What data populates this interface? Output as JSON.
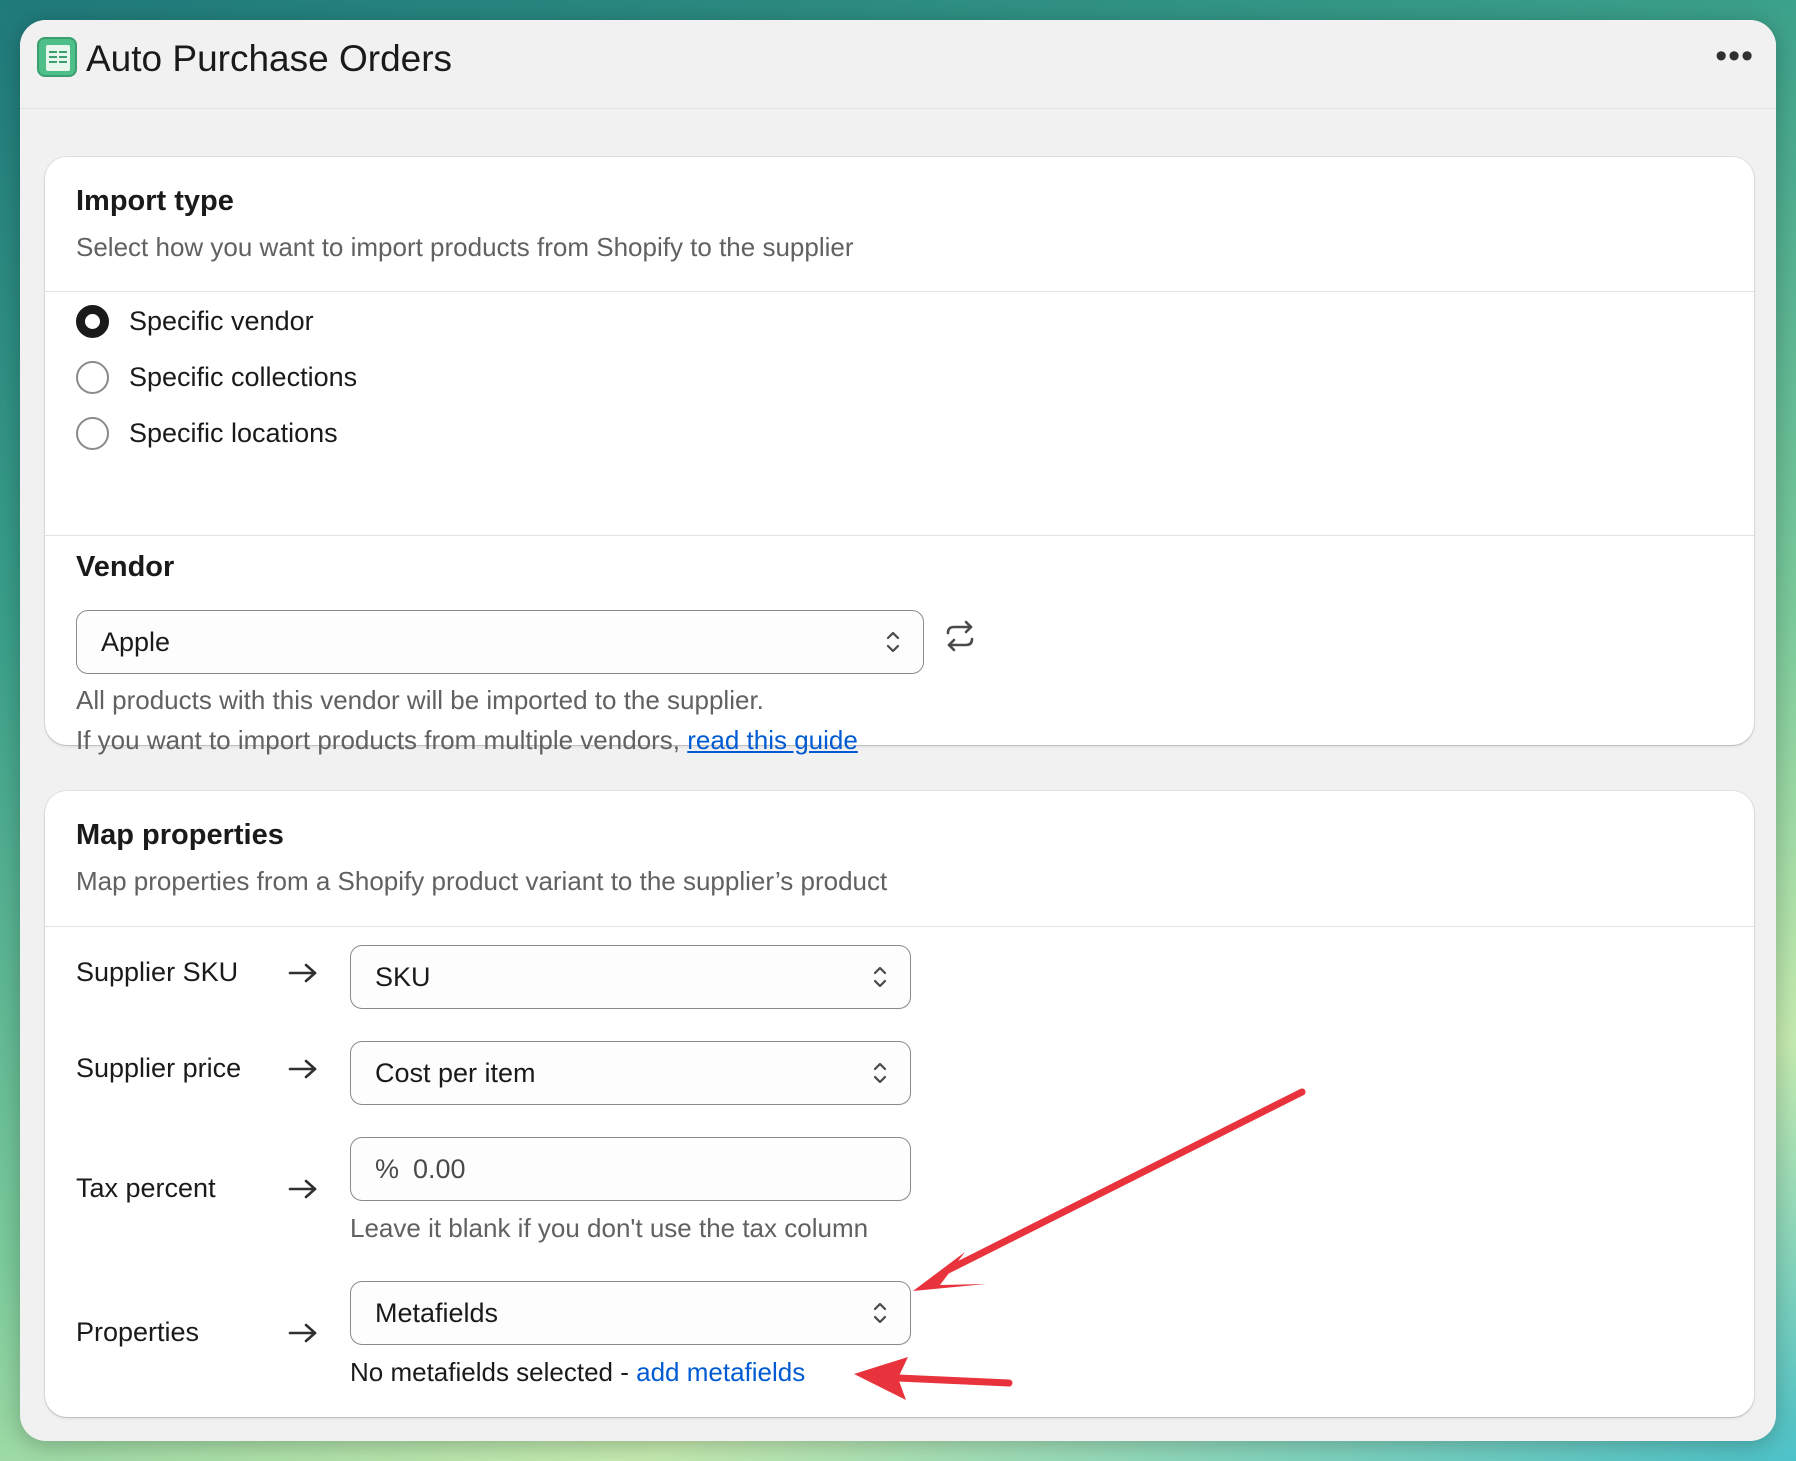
{
  "app": {
    "title": "Auto Purchase Orders",
    "more_label": "•••",
    "accent_color": "#4fbf8a"
  },
  "import_type": {
    "heading": "Import type",
    "description": "Select how you want to import products from Shopify to the supplier",
    "options": [
      {
        "label": "Specific vendor",
        "selected": true
      },
      {
        "label": "Specific collections",
        "selected": false
      },
      {
        "label": "Specific locations",
        "selected": false
      }
    ]
  },
  "vendor": {
    "heading": "Vendor",
    "selected_value": "Apple",
    "help_line1": "All products with this vendor will be imported to the supplier.",
    "help_line2_prefix": "If you want to import products from multiple vendors, ",
    "help_link": "read this guide"
  },
  "map_properties": {
    "heading": "Map properties",
    "description": "Map properties from a Shopify product variant to the supplier’s product",
    "rows": {
      "sku": {
        "label": "Supplier SKU",
        "value": "SKU"
      },
      "price": {
        "label": "Supplier price",
        "value": "Cost per item"
      },
      "tax": {
        "label": "Tax percent",
        "prefix": "%",
        "placeholder": "0.00",
        "help": "Leave it blank if you don't use the tax column"
      },
      "properties": {
        "label": "Properties",
        "value": "Metafields",
        "status_text": "No metafields selected - ",
        "link": "add metafields"
      }
    }
  },
  "annotation": {
    "arrow_color": "#e8333c"
  }
}
